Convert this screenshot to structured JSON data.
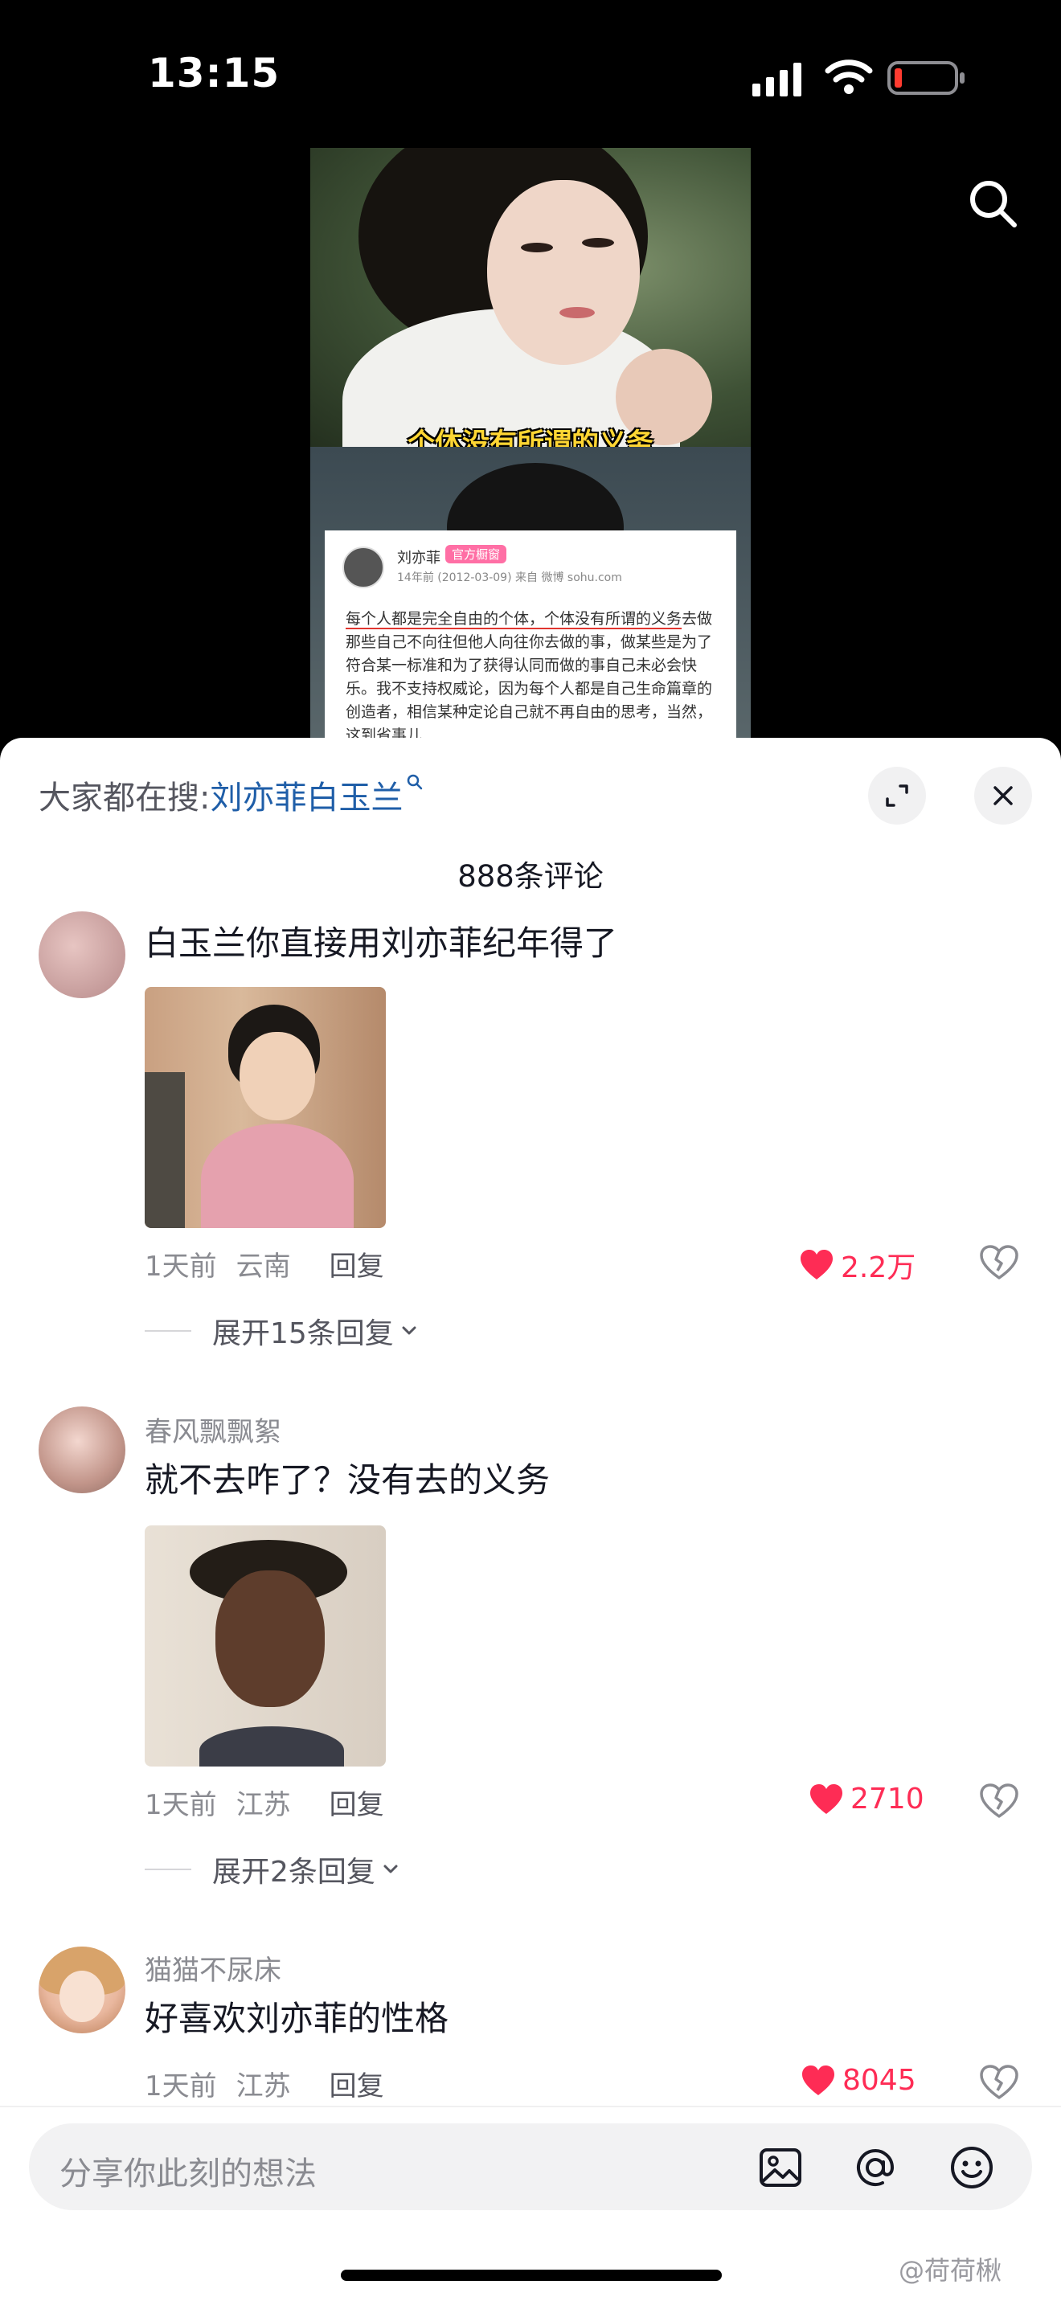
{
  "status_bar": {
    "time": "13:15"
  },
  "video": {
    "caption": "个体没有所谓的义务",
    "weibo_card": {
      "name": "刘亦菲",
      "badge": "官方橱窗",
      "meta": "14年前 (2012-03-09)  来自 微博 sohu.com",
      "text_underlined": "每个人都是完全自由的个体，个体没有所谓的义务",
      "text_rest": "去做那些自己不向往但他人向往你去做的事，做某些是为了符合某一标准和为了获得认同而做的事自己未必会快乐。我不支持权威论，因为每个人都是自己生命篇章的创造者，相信某种定论自己就不再自由的思考，当然，这到省事儿"
    }
  },
  "sheet": {
    "search_prefix": "大家都在搜:",
    "search_term": "刘亦菲白玉兰",
    "comment_count": "888条评论"
  },
  "comments": [
    {
      "user": "",
      "text": "白玉兰你直接用刘亦菲纪年得了",
      "time": "1天前",
      "location": "云南",
      "reply": "回复",
      "likes": "2.2万",
      "expand": "展开15条回复"
    },
    {
      "user": "春风飘飘絮",
      "text": "就不去咋了？没有去的义务",
      "time": "1天前",
      "location": "江苏",
      "reply": "回复",
      "likes": "2710",
      "expand": "展开2条回复"
    },
    {
      "user": "猫猫不尿床",
      "text": "好喜欢刘亦菲的性格",
      "time": "1天前",
      "location": "江苏",
      "reply": "回复",
      "likes": "8045"
    }
  ],
  "input": {
    "placeholder": "分享你此刻的想法"
  },
  "watermark": "@荷荷楸",
  "colors": {
    "like_red": "#fe2c55",
    "search_term_blue": "#1f5ea8"
  },
  "icons": [
    "search-icon",
    "expand-icon",
    "close-icon",
    "search-small-icon",
    "heart-icon",
    "broken-heart-icon",
    "chevron-down-icon",
    "image-icon",
    "at-icon",
    "emoji-icon",
    "signal-icon",
    "wifi-icon",
    "battery-icon"
  ]
}
